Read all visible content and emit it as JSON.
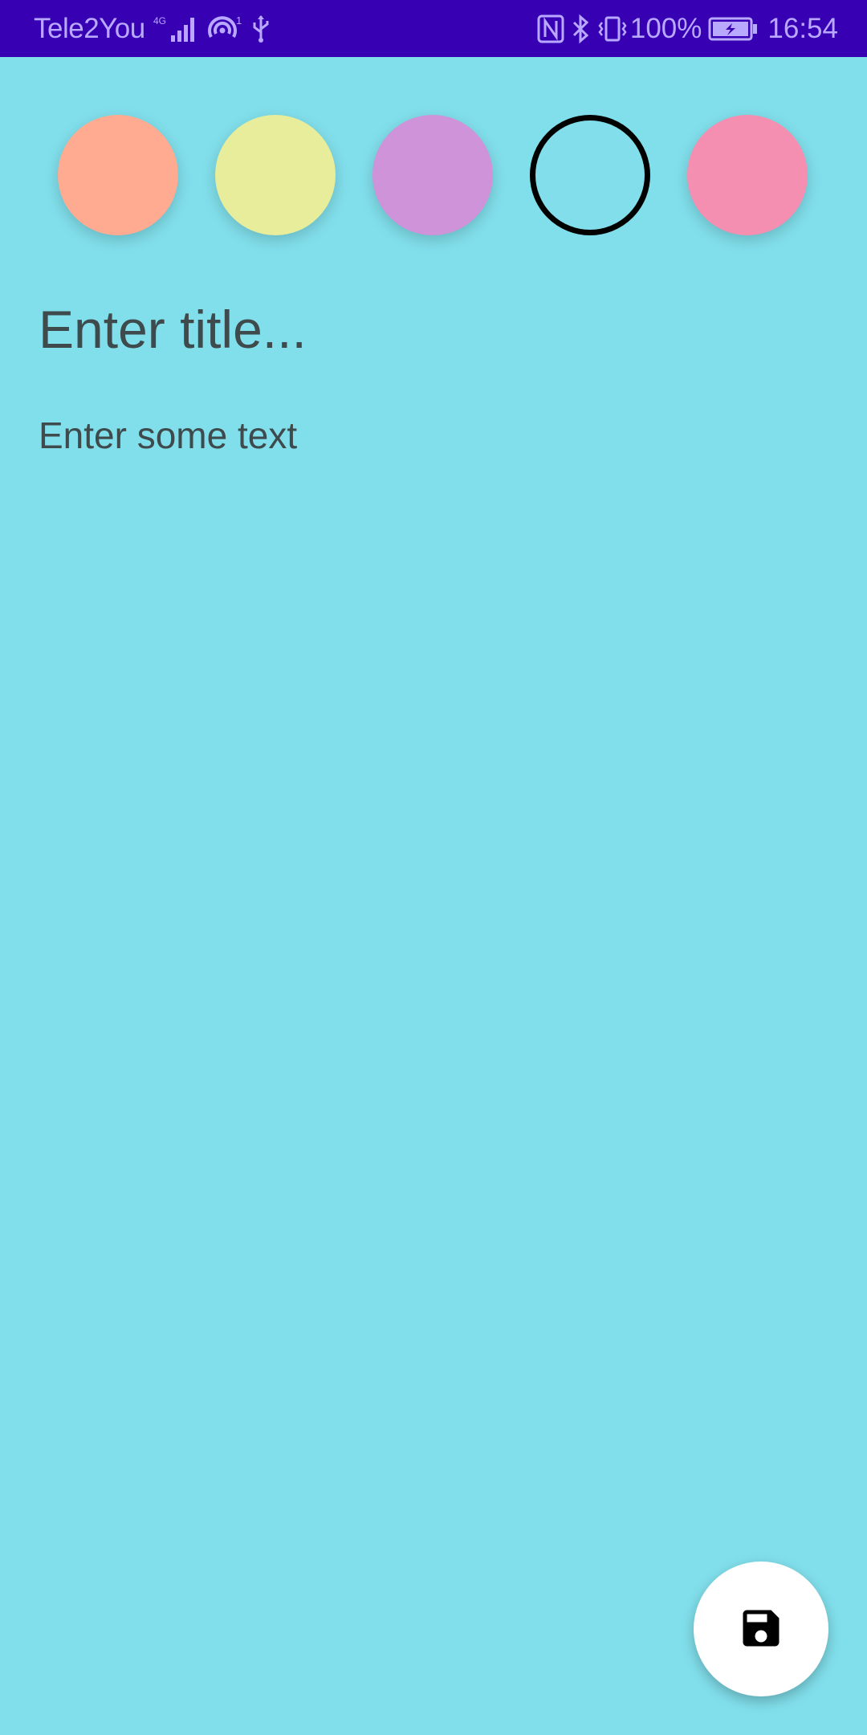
{
  "status_bar": {
    "carrier": "Tele2You",
    "network_type": "4G",
    "hotspot_count": "1",
    "battery_percent": "100%",
    "time": "16:54",
    "icons": [
      "signal-icon",
      "hotspot-icon",
      "usb-icon",
      "nfc-icon",
      "bluetooth-icon",
      "vibrate-icon",
      "battery-charging-icon"
    ]
  },
  "color_picker": {
    "colors": [
      "#ffab91",
      "#e7ed9b",
      "#ce93d8",
      "#81deea",
      "#f48fb1"
    ],
    "selected_index": 3
  },
  "editor": {
    "title_placeholder": "Enter title...",
    "body_placeholder": "Enter some text"
  },
  "fab": {
    "icon": "save-icon"
  },
  "theme": {
    "background": "#81dfeb",
    "status_bar": "#3700b3"
  }
}
